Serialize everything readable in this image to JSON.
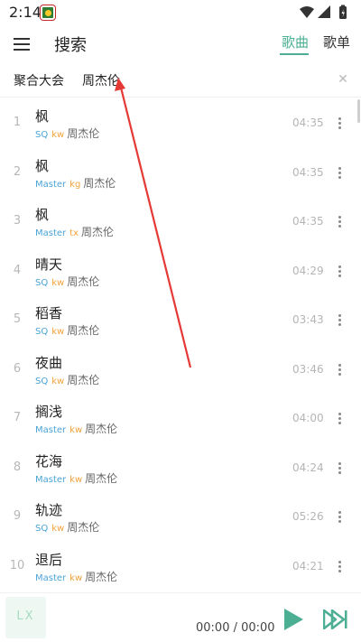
{
  "status_bar": {
    "time": "2:14",
    "icons": [
      "app-icon",
      "wifi-icon",
      "signal-icon",
      "battery-icon"
    ]
  },
  "header": {
    "title": "搜索",
    "tabs": [
      {
        "label": "歌曲",
        "active": true
      },
      {
        "label": "歌单",
        "active": false
      }
    ]
  },
  "search": {
    "source": "聚合大会",
    "query": "周杰伦",
    "clear_icon": "close-icon"
  },
  "songs": [
    {
      "index": "1",
      "title": "枫",
      "quality": "SQ",
      "source": "kw",
      "artist": "周杰伦",
      "duration": "04:35"
    },
    {
      "index": "2",
      "title": "枫",
      "quality": "Master",
      "source": "kg",
      "artist": "周杰伦",
      "duration": "04:35"
    },
    {
      "index": "3",
      "title": "枫",
      "quality": "Master",
      "source": "tx",
      "artist": "周杰伦",
      "duration": "04:35"
    },
    {
      "index": "4",
      "title": "晴天",
      "quality": "SQ",
      "source": "kw",
      "artist": "周杰伦",
      "duration": "04:29"
    },
    {
      "index": "5",
      "title": "稻香",
      "quality": "SQ",
      "source": "kw",
      "artist": "周杰伦",
      "duration": "03:43"
    },
    {
      "index": "6",
      "title": "夜曲",
      "quality": "SQ",
      "source": "kw",
      "artist": "周杰伦",
      "duration": "03:46"
    },
    {
      "index": "7",
      "title": "搁浅",
      "quality": "Master",
      "source": "kw",
      "artist": "周杰伦",
      "duration": "04:00"
    },
    {
      "index": "8",
      "title": "花海",
      "quality": "Master",
      "source": "kw",
      "artist": "周杰伦",
      "duration": "04:24"
    },
    {
      "index": "9",
      "title": "轨迹",
      "quality": "SQ",
      "source": "kw",
      "artist": "周杰伦",
      "duration": "05:26"
    },
    {
      "index": "10",
      "title": "退后",
      "quality": "Master",
      "source": "kw",
      "artist": "周杰伦",
      "duration": "04:21"
    }
  ],
  "player": {
    "cover_text": "LX",
    "time": "00:00 / 00:00",
    "play_icon": "play-icon",
    "next_icon": "skip-next-icon"
  },
  "colors": {
    "accent": "#4caf93",
    "quality": "#4aa3d6",
    "source": "#f0a23a",
    "annotation_arrow": "#e53935"
  }
}
